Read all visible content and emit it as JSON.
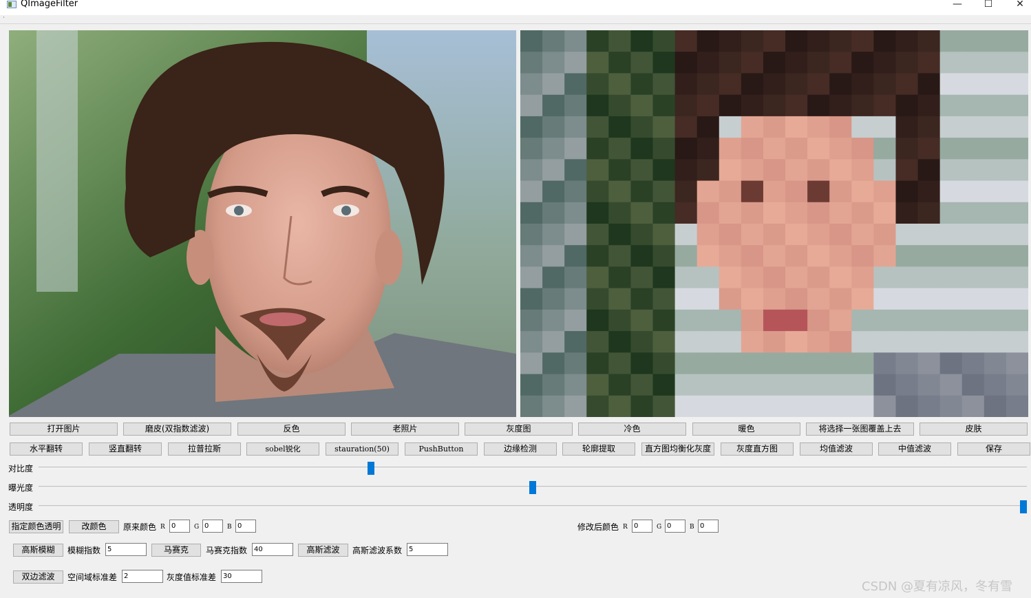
{
  "window": {
    "title": "QImageFilter",
    "controls": {
      "minimize": "—",
      "maximize": "☐",
      "close": "✕"
    },
    "menu_glyph": "·"
  },
  "images": {
    "original": {
      "description_icon": "portrait-photo"
    },
    "processed": {
      "effect": "mosaic"
    }
  },
  "row1_buttons": [
    "打开图片",
    "磨皮(双指数滤波)",
    "反色",
    "老照片",
    "灰度图",
    "冷色",
    "暖色",
    "将选择一张图覆盖上去",
    "皮肤"
  ],
  "row2_buttons": [
    "水平翻转",
    "竖直翻转",
    "拉普拉斯",
    "sobel锐化",
    "stauration(50)",
    "PushButton",
    "边缘检测",
    "轮廓提取",
    "直方图均衡化灰度",
    "灰度直方图",
    "均值滤波",
    "中值滤波",
    "保存"
  ],
  "sliders": [
    {
      "label": "对比度",
      "level": 0.335
    },
    {
      "label": "曝光度",
      "level": 0.5
    },
    {
      "label": "透明度",
      "level": 1.0
    }
  ],
  "color_row": {
    "transparent_button": "指定颜色透明",
    "change_button": "改颜色",
    "original_label": "原来颜色",
    "modified_label": "修改后颜色",
    "channel_labels": [
      "R",
      "G",
      "B"
    ],
    "original_values": [
      "0",
      "0",
      "0"
    ],
    "modified_values": [
      "0",
      "0",
      "0"
    ]
  },
  "blur_row": {
    "gaussian_blur_button": "高斯模糊",
    "blur_index_label": "模糊指数",
    "blur_index_value": "5",
    "mosaic_button": "马赛克",
    "mosaic_index_label": "马赛克指数",
    "mosaic_index_value": "40",
    "gaussian_filter_button": "高斯滤波",
    "gaussian_coef_label": "高斯滤波系数",
    "gaussian_coef_value": "5"
  },
  "bilateral_row": {
    "bilateral_button": "双边滤波",
    "spatial_sigma_label": "空间域标准差",
    "spatial_sigma_value": "2",
    "range_sigma_label": "灰度值标准差",
    "range_sigma_value": "30"
  },
  "watermark": "CSDN @夏有凉风，冬有雪",
  "colors": {
    "accent": "#0078d7",
    "button_bg": "#e1e1e1",
    "window_bg": "#f0f0f0"
  }
}
